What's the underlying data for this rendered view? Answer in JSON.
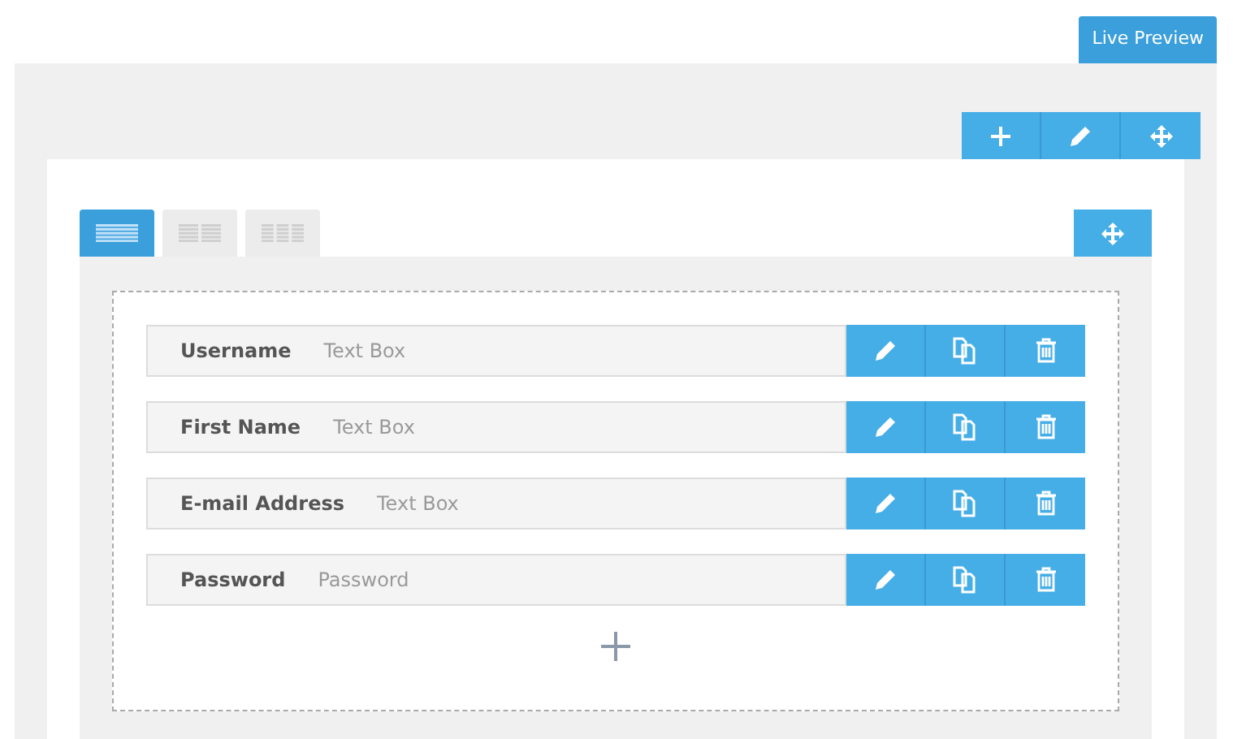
{
  "live_preview": "Live Preview",
  "layout_tabs": [
    {
      "kind": "one-column",
      "selected": true
    },
    {
      "kind": "two-column",
      "selected": false
    },
    {
      "kind": "three-column",
      "selected": false
    }
  ],
  "fields": [
    {
      "label": "Username",
      "type": "Text Box"
    },
    {
      "label": "First Name",
      "type": "Text Box"
    },
    {
      "label": "E-mail Address",
      "type": "Text Box"
    },
    {
      "label": "Password",
      "type": "Password"
    }
  ]
}
